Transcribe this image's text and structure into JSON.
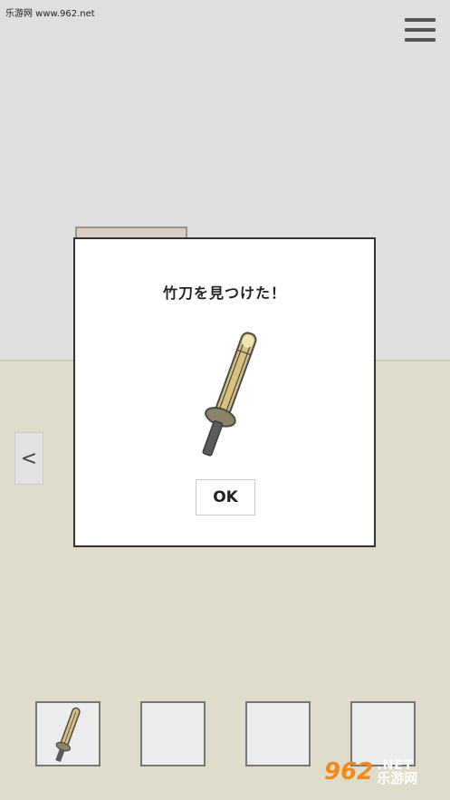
{
  "watermark": {
    "top_text": "乐游网 www.962.net",
    "logo": "962",
    "net": ".NET",
    "cn": "乐游网"
  },
  "menu": {
    "icon": "hamburger-menu-icon"
  },
  "nav": {
    "left_label": "<"
  },
  "dialog": {
    "title": "竹刀を見つけた！",
    "item_icon": "bamboo-sword-icon",
    "ok_label": "OK"
  },
  "inventory": {
    "slots": [
      {
        "item": "bamboo-sword-icon"
      },
      {
        "item": ""
      },
      {
        "item": ""
      },
      {
        "item": ""
      }
    ]
  },
  "colors": {
    "wall": "#dfdfdf",
    "floor": "#e0dccb",
    "dialog_bg": "#ffffff",
    "sword_blade": "#d8c07f",
    "sword_guard": "#8a8367",
    "sword_handle": "#5b5b5b"
  }
}
